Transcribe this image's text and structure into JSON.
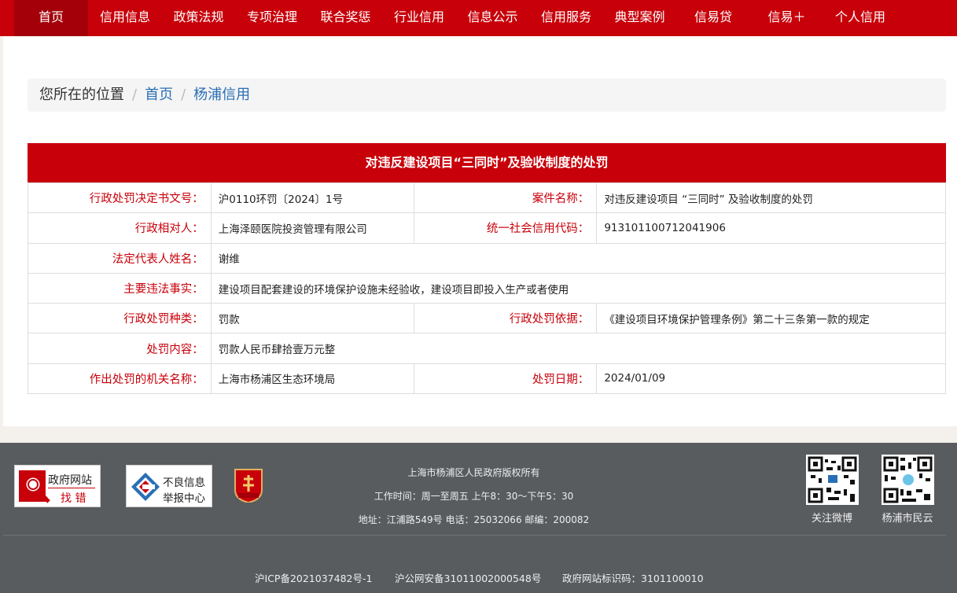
{
  "nav": {
    "items": [
      "首页",
      "信用信息",
      "政策法规",
      "专项治理",
      "联合奖惩",
      "行业信用",
      "信息公示",
      "信用服务",
      "典型案例",
      "信易贷",
      "信易＋",
      "个人信用"
    ]
  },
  "breadcrumb": {
    "prefix": "您所在的位置",
    "sep": "/",
    "home": "首页",
    "current": "杨浦信用"
  },
  "detail": {
    "title": "对违反建设项目“三同时”及验收制度的处罚",
    "labels": {
      "doc_no": "行政处罚决定书文号：",
      "case_name": "案件名称：",
      "party": "行政相对人：",
      "credit_code": "统一社会信用代码：",
      "legal_rep": "法定代表人姓名：",
      "facts": "主要违法事实：",
      "type": "行政处罚种类：",
      "basis": "行政处罚依据：",
      "content": "处罚内容：",
      "authority": "作出处罚的机关名称：",
      "date": "处罚日期："
    },
    "values": {
      "doc_no": "沪0110环罚〔2024〕1号",
      "case_name": "对违反建设项目 “三同时” 及验收制度的处罚",
      "party": "上海泽颐医院投资管理有限公司",
      "credit_code": "913101100712041906",
      "legal_rep": "谢维",
      "facts": "建设项目配套建设的环境保护设施未经验收，建设项目即投入生产或者使用",
      "type": "罚款",
      "basis": "《建设项目环境保护管理条例》第二十三条第一款的规定",
      "content": "罚款人民币肆拾壹万元整",
      "authority": "上海市杨浦区生态环境局",
      "date": "2024/01/09"
    }
  },
  "footer": {
    "badge1": {
      "line1": "政府网站",
      "line2": "找 错"
    },
    "badge2": {
      "line1": "不良信息",
      "line2": "举报中心"
    },
    "copyright": "上海市杨浦区人民政府版权所有",
    "hours": "工作时间：周一至周五 上午8：30～下午5：30",
    "address": "地址：江浦路549号 电话：25032066 邮编：200082",
    "qr1_caption": "关注微博",
    "qr2_caption": "杨浦市民云",
    "icp": "沪ICP备2021037482号-1",
    "police": "沪公网安备31011002000548号",
    "site_id": "政府网站标识码：3101100010"
  },
  "colors": {
    "brand_red": "#c8000a",
    "footer_bg": "#595c5f",
    "link_blue": "#2a6fb5"
  }
}
